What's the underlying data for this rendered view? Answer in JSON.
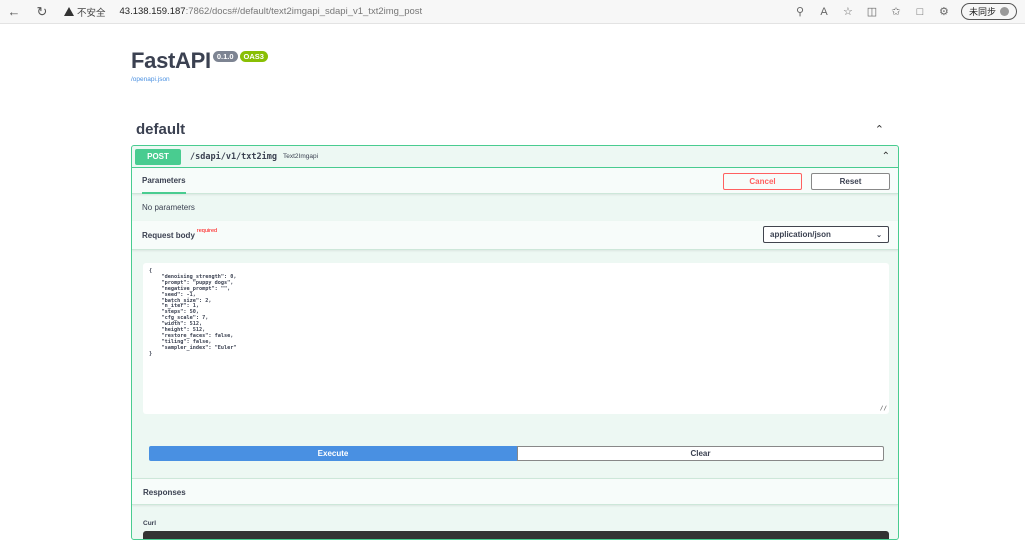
{
  "browser": {
    "security_label": "不安全",
    "url_host": "43.138.159.187",
    "url_rest": ":7862/docs#/default/text2imgapi_sdapi_v1_txt2img_post",
    "sync_label": "未同步"
  },
  "info": {
    "title": "FastAPI",
    "version": "0.1.0",
    "oas": "OAS3",
    "openapi_link": "/openapi.json"
  },
  "tag": {
    "name": "default"
  },
  "operation": {
    "method": "POST",
    "path": "/sdapi/v1/txt2img",
    "description": "Text2Imgapi",
    "params_tab": "Parameters",
    "cancel_label": "Cancel",
    "reset_label": "Reset",
    "no_params": "No parameters",
    "request_body_label": "Request body",
    "required_label": "required",
    "content_type": "application/json",
    "request_body": "{\n    \"denoising_strength\": 0,\n    \"prompt\": \"puppy dogs\",\n    \"negative_prompt\": \"\",\n    \"seed\": -1,\n    \"batch_size\": 2,\n    \"n_iter\": 1,\n    \"steps\": 50,\n    \"cfg_scale\": 7,\n    \"width\": 512,\n    \"height\": 512,\n    \"restore_faces\": false,\n    \"tiling\": false,\n    \"sampler_index\": \"Euler\"\n}",
    "execute_label": "Execute",
    "clear_label": "Clear",
    "responses_label": "Responses",
    "curl_label": "Curl"
  },
  "colors": {
    "post_green": "#49cc90",
    "execute_blue": "#4990e2",
    "cancel_red": "#ff6060"
  }
}
